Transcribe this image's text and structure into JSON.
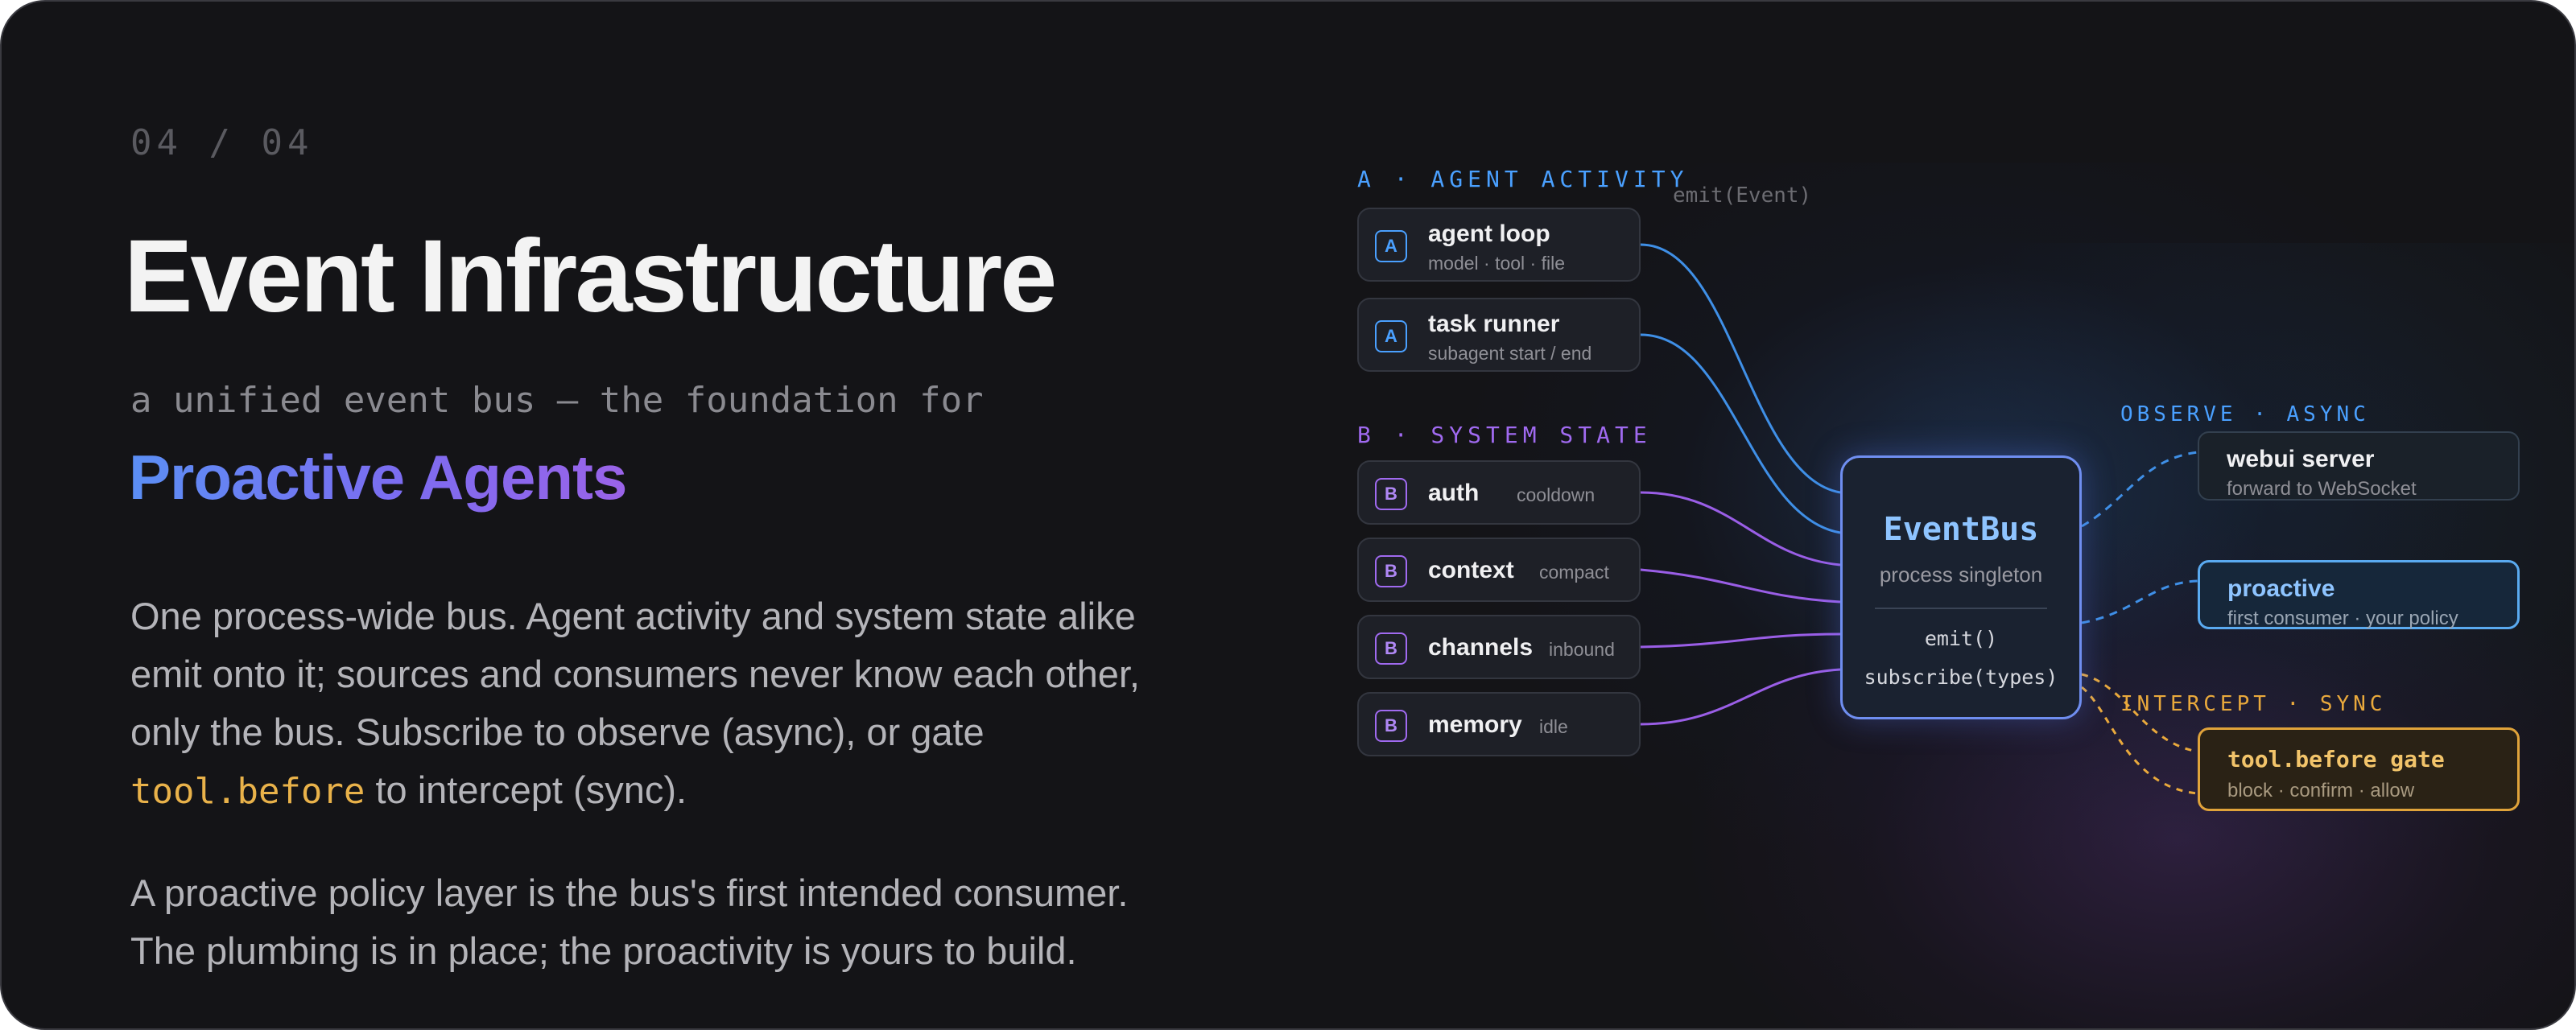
{
  "slide": {
    "counter": "04 / 04",
    "title": "Event Infrastructure",
    "subtitle": "a unified event bus — the foundation for",
    "accent_title": "Proactive Agents",
    "paragraph1": {
      "line1": "One process-wide bus. Agent activity and system state alike",
      "line2": "emit onto it; sources and consumers never know each other,",
      "line3": "only the bus. Subscribe to observe (async), or gate",
      "code": "tool.before",
      "line4_rest": " to intercept (sync)."
    },
    "paragraph2": {
      "line1": "A proactive policy layer is the bus's first intended consumer.",
      "line2": "The plumbing is in place; the proactivity is yours to build."
    }
  },
  "diagram": {
    "section_a": "A · AGENT ACTIVITY",
    "section_b": "B · SYSTEM STATE",
    "emit_label": "emit(Event)",
    "observe_label": "OBSERVE · ASYNC",
    "intercept_label": "INTERCEPT · SYNC",
    "agent_sources": [
      {
        "badge": "A",
        "title": "agent loop",
        "sub": "model · tool · file"
      },
      {
        "badge": "A",
        "title": "task runner",
        "sub": "subagent start / end"
      }
    ],
    "state_sources": [
      {
        "badge": "B",
        "title": "auth",
        "sub": "cooldown"
      },
      {
        "badge": "B",
        "title": "context",
        "sub": "compact"
      },
      {
        "badge": "B",
        "title": "channels",
        "sub": "inbound"
      },
      {
        "badge": "B",
        "title": "memory",
        "sub": "idle"
      }
    ],
    "bus": {
      "title": "EventBus",
      "subtitle": "process singleton",
      "method1": "emit()",
      "method2": "subscribe(types)"
    },
    "consumers": [
      {
        "title": "webui server",
        "sub": "forward to WebSocket"
      },
      {
        "title": "proactive",
        "sub": "first consumer · your policy"
      },
      {
        "title": "tool.before gate",
        "sub": "block · confirm · allow"
      }
    ],
    "colors": {
      "agent": "#4aa0ff",
      "state": "#a06af0",
      "observe": "#4aa0ff",
      "intercept": "#e9a93c",
      "bus_border": "#6f8ef0"
    }
  }
}
